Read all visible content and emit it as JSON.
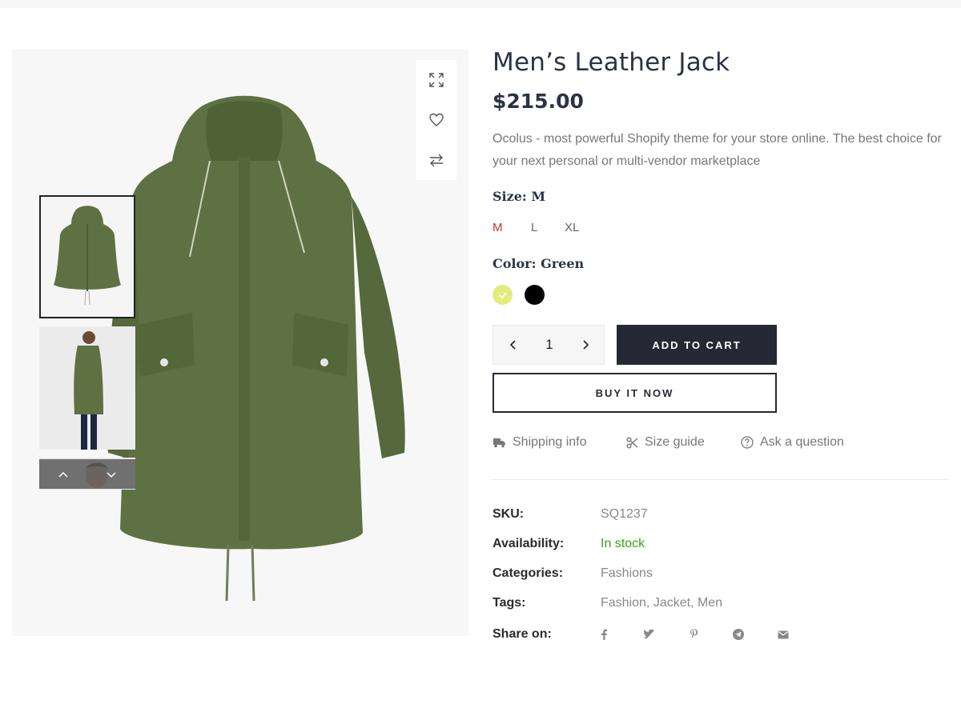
{
  "product": {
    "title": "Men’s Leather Jack",
    "price": "$215.00",
    "description": "Ocolus - most powerful Shopify theme for your store online. The best choice for your next personal or multi-vendor marketplace"
  },
  "gallery": {
    "tools": [
      "expand-icon",
      "heart-icon",
      "compare-icon"
    ],
    "thumbnails": [
      "green parka front",
      "man wearing parka side view",
      "man portrait"
    ]
  },
  "options": {
    "size_label": "Size:",
    "size_value": "M",
    "sizes": [
      "M",
      "L",
      "XL"
    ],
    "selected_size": "M",
    "color_label": "Color:",
    "color_value": "Green",
    "colors": [
      {
        "name": "Green",
        "hex": "#e2ec7c",
        "selected": true
      },
      {
        "name": "Black",
        "hex": "#000000",
        "selected": false
      }
    ]
  },
  "cart": {
    "quantity": "1",
    "add_to_cart": "ADD TO CART",
    "buy_now": "BUY IT NOW"
  },
  "links": {
    "shipping": "Shipping info",
    "size_guide": "Size guide",
    "ask": "Ask a question"
  },
  "meta": {
    "sku_label": "SKU:",
    "sku": "SQ1237",
    "availability_label": "Availability:",
    "availability": "In stock",
    "categories_label": "Categories:",
    "categories": "Fashions",
    "tags_label": "Tags:",
    "tags": "Fashion, Jacket, Men",
    "share_label": "Share on:",
    "share": [
      "facebook-icon",
      "twitter-icon",
      "pinterest-icon",
      "telegram-icon",
      "email-icon"
    ]
  },
  "colors": {
    "dark": "#262935",
    "heading": "#2b3445",
    "accent_red": "#c0392b",
    "stock_green": "#3aa313",
    "jacket_green": "#5d7142"
  }
}
